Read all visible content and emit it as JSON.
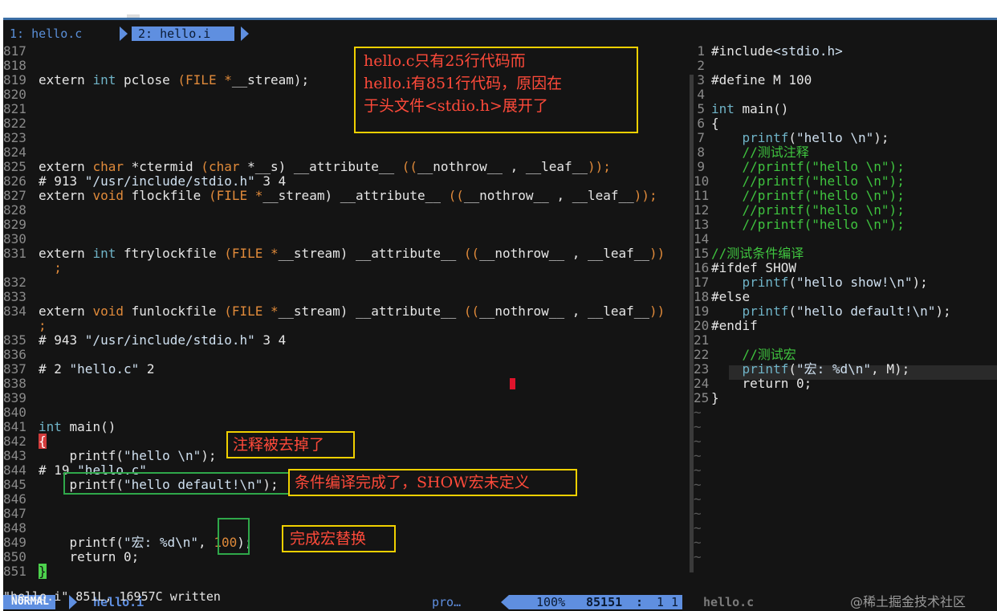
{
  "tabs": {
    "tab1": "1: hello.c",
    "tab2": "2: hello.i"
  },
  "left_lines": [
    {
      "n": "817",
      "code": []
    },
    {
      "n": "818",
      "code": []
    },
    {
      "n": "819",
      "code": [
        [
          "extern ",
          "pp"
        ],
        [
          "int",
          "kw"
        ],
        [
          " pclose ",
          "pp"
        ],
        [
          "(FILE",
          "ty"
        ],
        [
          " ",
          "pp"
        ],
        [
          "*",
          "ty"
        ],
        [
          "__stream);",
          "pp"
        ]
      ]
    },
    {
      "n": "820",
      "code": []
    },
    {
      "n": "821",
      "code": []
    },
    {
      "n": "822",
      "code": []
    },
    {
      "n": "823",
      "code": []
    },
    {
      "n": "824",
      "code": []
    },
    {
      "n": "825",
      "code": [
        [
          "extern ",
          "pp"
        ],
        [
          "char",
          "ty"
        ],
        [
          " *ctermid ",
          "pp"
        ],
        [
          "(",
          "ty"
        ],
        [
          "char",
          "ty"
        ],
        [
          " *__s) __attribute__ ",
          "pp"
        ],
        [
          "((",
          "ty"
        ],
        [
          "__nothrow__ , __leaf__",
          "pp"
        ],
        [
          "));",
          "ty"
        ]
      ]
    },
    {
      "n": "826",
      "code": [
        [
          "# 913 ",
          "pp"
        ],
        [
          "\"/usr/include/stdio.h\"",
          "str"
        ],
        [
          " 3 4",
          "pp"
        ]
      ]
    },
    {
      "n": "827",
      "code": [
        [
          "extern ",
          "pp"
        ],
        [
          "void",
          "ty"
        ],
        [
          " flockfile ",
          "pp"
        ],
        [
          "(FILE",
          "ty"
        ],
        [
          " ",
          "pp"
        ],
        [
          "*",
          "ty"
        ],
        [
          "__stream) __attribute__ ",
          "pp"
        ],
        [
          "((",
          "ty"
        ],
        [
          "__nothrow__ , __leaf__",
          "pp"
        ],
        [
          "));",
          "ty"
        ]
      ]
    },
    {
      "n": "828",
      "code": []
    },
    {
      "n": "829",
      "code": []
    },
    {
      "n": "830",
      "code": []
    },
    {
      "n": "831",
      "code": [
        [
          "extern ",
          "pp"
        ],
        [
          "int",
          "kw"
        ],
        [
          " ftrylockfile ",
          "pp"
        ],
        [
          "(FILE",
          "ty"
        ],
        [
          " ",
          "pp"
        ],
        [
          "*",
          "ty"
        ],
        [
          "__stream) __attribute__ ",
          "pp"
        ],
        [
          "((",
          "ty"
        ],
        [
          "__nothrow__ , __leaf__",
          "pp"
        ],
        [
          "))",
          "ty"
        ]
      ]
    },
    {
      "n": "",
      "code": [
        [
          "  ;",
          "ty"
        ]
      ]
    },
    {
      "n": "832",
      "code": []
    },
    {
      "n": "833",
      "code": []
    },
    {
      "n": "834",
      "code": [
        [
          "extern ",
          "pp"
        ],
        [
          "void",
          "ty"
        ],
        [
          " funlockfile ",
          "pp"
        ],
        [
          "(FILE",
          "ty"
        ],
        [
          " ",
          "pp"
        ],
        [
          "*",
          "ty"
        ],
        [
          "__stream) __attribute__ ",
          "pp"
        ],
        [
          "((",
          "ty"
        ],
        [
          "__nothrow__ , __leaf__",
          "pp"
        ],
        [
          "))",
          "ty"
        ]
      ]
    },
    {
      "n": "",
      "code": [
        [
          ";",
          "ty"
        ]
      ]
    },
    {
      "n": "835",
      "code": [
        [
          "# 943 ",
          "pp"
        ],
        [
          "\"/usr/include/stdio.h\"",
          "str"
        ],
        [
          " 3 4",
          "pp"
        ]
      ]
    },
    {
      "n": "836",
      "code": []
    },
    {
      "n": "837",
      "code": [
        [
          "# 2 ",
          "pp"
        ],
        [
          "\"hello.c\"",
          "str"
        ],
        [
          " 2",
          "pp"
        ]
      ]
    },
    {
      "n": "838",
      "code": []
    },
    {
      "n": "839",
      "code": []
    },
    {
      "n": "840",
      "code": []
    },
    {
      "n": "841",
      "code": [
        [
          "int",
          "kw"
        ],
        [
          " main()",
          "pp"
        ]
      ]
    },
    {
      "n": "842",
      "code": [
        [
          "{",
          "bracehl"
        ]
      ]
    },
    {
      "n": "843",
      "code": [
        [
          "    printf(",
          "pp"
        ],
        [
          "\"hello \\n\"",
          "str"
        ],
        [
          ");",
          "pp"
        ]
      ]
    },
    {
      "n": "844",
      "code": [
        [
          "# 19 ",
          "pp"
        ],
        [
          "\"hello.c\"",
          "str"
        ]
      ]
    },
    {
      "n": "845",
      "code": [
        [
          "    printf(",
          "pp"
        ],
        [
          "\"hello default!\\n\"",
          "str"
        ],
        [
          ");",
          "pp"
        ]
      ]
    },
    {
      "n": "846",
      "code": []
    },
    {
      "n": "847",
      "code": []
    },
    {
      "n": "848",
      "code": []
    },
    {
      "n": "849",
      "code": [
        [
          "    printf(",
          "pp"
        ],
        [
          "\"宏: %d\\n\"",
          "str"
        ],
        [
          ", ",
          "pp"
        ],
        [
          "100",
          "ty"
        ],
        [
          ");",
          "pp"
        ]
      ]
    },
    {
      "n": "850",
      "code": [
        [
          "    return 0;",
          "pp"
        ]
      ]
    },
    {
      "n": "851",
      "code": [
        [
          "}",
          "bracecur"
        ]
      ]
    }
  ],
  "right_lines": [
    {
      "n": "1",
      "code": [
        [
          "#include",
          "pp"
        ],
        [
          "<stdio.h>",
          "str"
        ]
      ]
    },
    {
      "n": "2",
      "code": []
    },
    {
      "n": "3",
      "code": [
        [
          "#define M 100",
          "pp"
        ]
      ]
    },
    {
      "n": "4",
      "code": []
    },
    {
      "n": "5",
      "code": [
        [
          "int",
          "kw"
        ],
        [
          " main()",
          "pp"
        ]
      ]
    },
    {
      "n": "6",
      "code": [
        [
          "{",
          "pp"
        ]
      ]
    },
    {
      "n": "7",
      "code": [
        [
          "    ",
          "pp"
        ],
        [
          "printf",
          "kw"
        ],
        [
          "(",
          "pp"
        ],
        [
          "\"hello \\n\"",
          "str"
        ],
        [
          ");",
          "pp"
        ]
      ]
    },
    {
      "n": "8",
      "code": [
        [
          "    //测试注释",
          "cm"
        ]
      ]
    },
    {
      "n": "9",
      "code": [
        [
          "    //printf(\"hello \\n\");",
          "cm"
        ]
      ]
    },
    {
      "n": "10",
      "code": [
        [
          "    //printf(\"hello \\n\");",
          "cm"
        ]
      ]
    },
    {
      "n": "11",
      "code": [
        [
          "    //printf(\"hello \\n\");",
          "cm"
        ]
      ]
    },
    {
      "n": "12",
      "code": [
        [
          "    //printf(\"hello \\n\");",
          "cm"
        ]
      ]
    },
    {
      "n": "13",
      "code": [
        [
          "    //printf(\"hello \\n\");",
          "cm"
        ]
      ]
    },
    {
      "n": "14",
      "code": []
    },
    {
      "n": "15",
      "code": [
        [
          "//测试条件编译",
          "cm"
        ]
      ]
    },
    {
      "n": "16",
      "code": [
        [
          "#ifdef SHOW",
          "pp"
        ]
      ]
    },
    {
      "n": "17",
      "code": [
        [
          "    ",
          "pp"
        ],
        [
          "printf",
          "kw"
        ],
        [
          "(",
          "pp"
        ],
        [
          "\"hello show!\\n\"",
          "str"
        ],
        [
          ");",
          "pp"
        ]
      ]
    },
    {
      "n": "18",
      "code": [
        [
          "#else",
          "pp"
        ]
      ]
    },
    {
      "n": "19",
      "code": [
        [
          "    ",
          "pp"
        ],
        [
          "printf",
          "kw"
        ],
        [
          "(",
          "pp"
        ],
        [
          "\"hello default!\\n\"",
          "str"
        ],
        [
          ");",
          "pp"
        ]
      ]
    },
    {
      "n": "20",
      "code": [
        [
          "#endif",
          "pp"
        ]
      ]
    },
    {
      "n": "21",
      "code": []
    },
    {
      "n": "22",
      "code": [
        [
          "    //测试宏",
          "cm"
        ]
      ]
    },
    {
      "n": "23",
      "code": [
        [
          "    ",
          "pp"
        ],
        [
          "printf",
          "kw"
        ],
        [
          "(",
          "pp"
        ],
        [
          "\"宏: %d\\n\"",
          "str"
        ],
        [
          ", M);",
          "pp"
        ]
      ]
    },
    {
      "n": "24",
      "code": [
        [
          "    return 0;",
          "pp"
        ]
      ]
    },
    {
      "n": "25",
      "code": [
        [
          "}",
          "pp"
        ]
      ]
    }
  ],
  "tilde_count": 11,
  "tilde_char": "~",
  "notes": {
    "note1": "hello.c只有25行代码而\nhello.i有851行代码，原因在\n于头文件<stdio.h>展开了",
    "note2": "注释被去掉了",
    "note3": "条件编译完成了，SHOW宏未定义",
    "note4": "完成宏替换"
  },
  "status": {
    "mode": "NORMAL",
    "filename": "hello.i",
    "pro": "pro…",
    "percent": "100%",
    "lines": "85151",
    "colon": ":",
    "col": "1 1",
    "right_filename": "hello.c",
    "watermark": "@稀土掘金技术社区"
  },
  "cmdline": "\"hello.i\" 851L, 16957C written",
  "colors": {
    "accent": "#5f8fe0",
    "note_border": "#f0d000",
    "note_text": "#ff4a3a",
    "green_box": "#2fa84a"
  }
}
